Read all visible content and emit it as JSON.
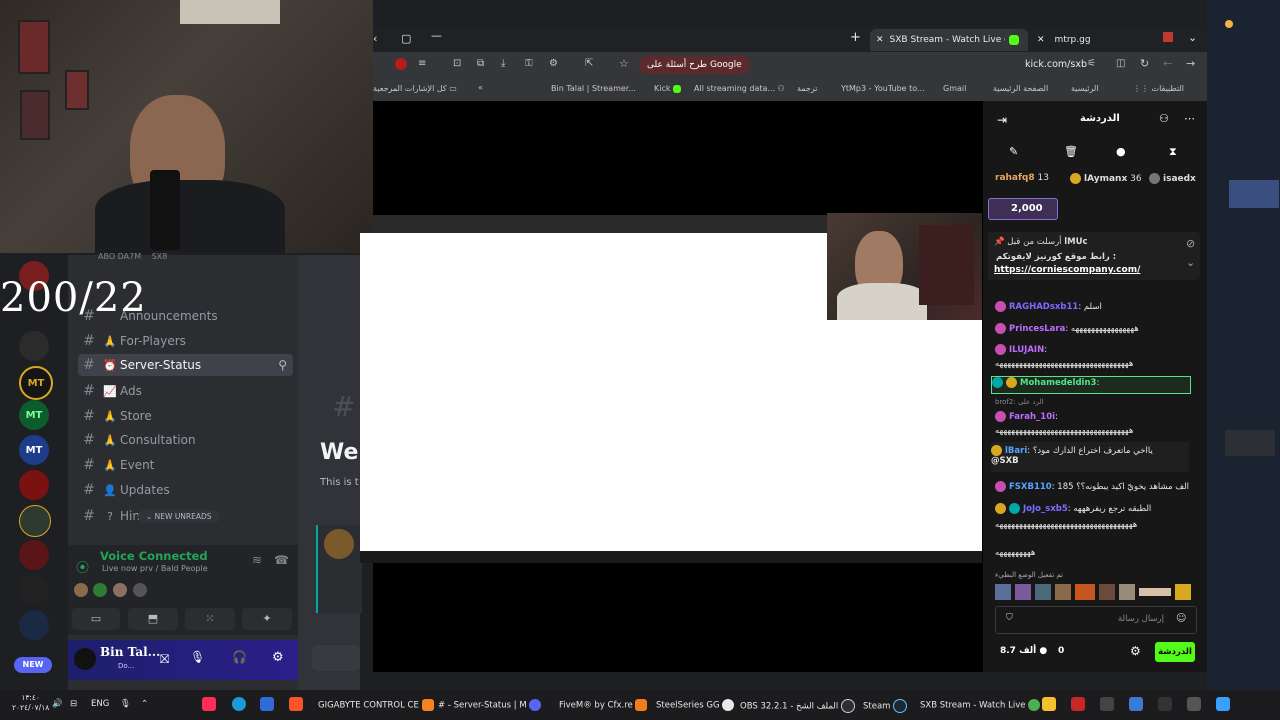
{
  "overlay": {
    "counter": "200/22"
  },
  "discord": {
    "top_names": [
      "ABO DA7M",
      "SX8"
    ],
    "channels": [
      {
        "name": "Announcements",
        "emoji": ""
      },
      {
        "name": "For-Players",
        "emoji": "🙏"
      },
      {
        "name": "Server-Status",
        "emoji": "⏰",
        "active": true
      },
      {
        "name": "Ads",
        "emoji": "📈"
      },
      {
        "name": "Store",
        "emoji": "🙏"
      },
      {
        "name": "Consultation",
        "emoji": "🙏"
      },
      {
        "name": "Event",
        "emoji": "🙏"
      },
      {
        "name": "Updates",
        "emoji": "👤"
      },
      {
        "name": "Hint",
        "emoji": "?"
      }
    ],
    "new_unreads": "NEW UNREADS",
    "voice_connected": "Voice Connected",
    "voice_channel": "Live now prv / Bald People",
    "user_name": "Bin Tal...",
    "user_status": "Do...",
    "main_heading": "Wel",
    "main_sub": "This is t",
    "new_badge": "NEW",
    "server_labels": [
      "MT",
      "MT",
      "MT"
    ]
  },
  "browser": {
    "tabs": [
      {
        "title": "SXB Stream - Watch Live on",
        "active": true
      },
      {
        "title": "mtrp.gg",
        "active": false
      }
    ],
    "url": "kick.com/sxb",
    "google_button": "طرح أسئلة على Google",
    "bookmarks": [
      "التطبيقات",
      "الرئيسية",
      "الصفحة الرئيسية",
      "Gmail",
      "YtMp3 - YouTube to...",
      "ترجمة",
      "All streaming data...",
      "Kick",
      "Bin Talal | Streamer...",
      "كل الإشارات المرجعية"
    ]
  },
  "chat": {
    "header": "الدردشة",
    "top_users": [
      {
        "name": "rahafq8",
        "count": "13"
      },
      {
        "name": "lAymanx",
        "count": "36"
      },
      {
        "name": "isaedx",
        "count": ""
      }
    ],
    "gift_amount": "2,000",
    "pinned_by": "lMUc",
    "pinned_label": "أرسلت من قبل",
    "pinned_text": "رابط موقع كورنيز لايفوتكم :",
    "pinned_link": "https://corniescompany.com/",
    "messages": [
      {
        "user": "RAGHADsxb11",
        "text": "اسلم",
        "color": "#7b6cff"
      },
      {
        "user": "PrincesLara",
        "text": "ههههههههههههههههه",
        "color": "#c06cff"
      },
      {
        "user": "ILUJAIN",
        "text": "",
        "color": "#c06cff"
      },
      {
        "user": "",
        "text": "ههههههههههههههههههههههههههههههههههه",
        "color": "#e6e6e6"
      },
      {
        "user": "Mohamedeldin3",
        "text": "",
        "color": "#57e389"
      },
      {
        "user": "Farah_10i",
        "text": "",
        "color": "#c06cff"
      },
      {
        "user": "",
        "text": "ههههههههههههههههههههههههههههههههههه",
        "color": "#e6e6e6"
      },
      {
        "user": "lBari",
        "text": "يااخي ماتعرف اختراع الدارك مود؟",
        "color": "#57a3ff"
      },
      {
        "user": "@SXB",
        "text": "",
        "color": "#e6e6e6"
      },
      {
        "user": "FSXB110",
        "text": "الف مشاهد يخويّ اكيد يبطونه؟؟ 185",
        "color": "#57a3ff"
      },
      {
        "user": "JoJo_sxb5",
        "text": "الطبقه ترجع ريفرهههه",
        "color": "#7b6cff"
      },
      {
        "user": "",
        "text": "هههههههههههههههههههههههههههههههههههه",
        "color": "#e6e6e6"
      },
      {
        "user": "",
        "text": "هههههههههه",
        "color": "#e6e6e6"
      }
    ],
    "reply_line": "brof2: الرد على",
    "system_line": "تم تفعيل الوضع البطيء",
    "input_placeholder": "إرسال رسالة",
    "send_label": "الدردشة",
    "points": "0",
    "viewers": "8.7 ألف"
  },
  "taskbar": {
    "time": "١٣:٤٠",
    "date": "٢٠٢٤/٠٧/١٨",
    "lang": "ENG",
    "apps": [
      "GIGABYTE CONTROL CE",
      "# - Server-Status | M",
      "FiveM® by Cfx.re",
      "SteelSeries GG",
      "OBS 32.2.1 - الملف الشخ",
      "Steam",
      "SXB Stream - Watch Live"
    ]
  },
  "colors": {
    "kick_green": "#53fc18",
    "discord_blurple": "#5865f2",
    "taskbar": "#1c1c1e"
  }
}
